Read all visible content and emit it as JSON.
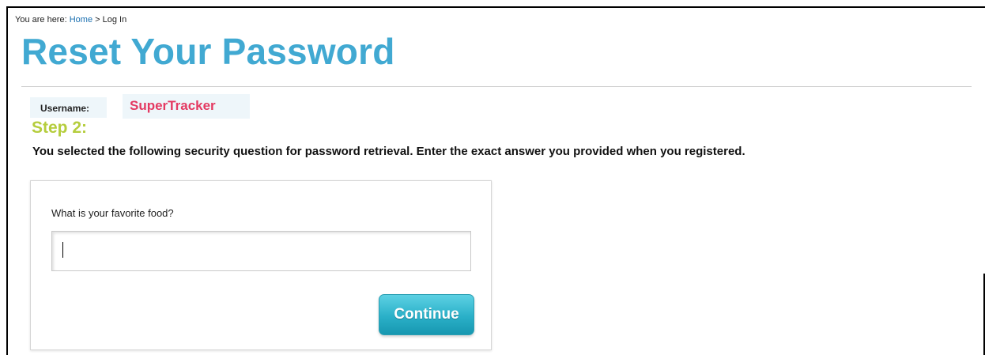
{
  "breadcrumb": {
    "prefix": "You are here:",
    "home_link": "Home",
    "separator": ">",
    "current": "Log In"
  },
  "page": {
    "title": "Reset Your Password"
  },
  "user": {
    "label": "Username:",
    "value": "SuperTracker"
  },
  "step": {
    "title": "Step 2:",
    "instructions": "You selected the following security question for password retrieval. Enter the exact answer you provided when you registered."
  },
  "form": {
    "question": "What is your favorite food?",
    "answer_value": "",
    "continue_label": "Continue"
  },
  "colors": {
    "title": "#41a9d2",
    "step": "#b5cd3d",
    "username": "#e43a62",
    "button": "#2ab0c8",
    "link": "#1a6fb0"
  }
}
